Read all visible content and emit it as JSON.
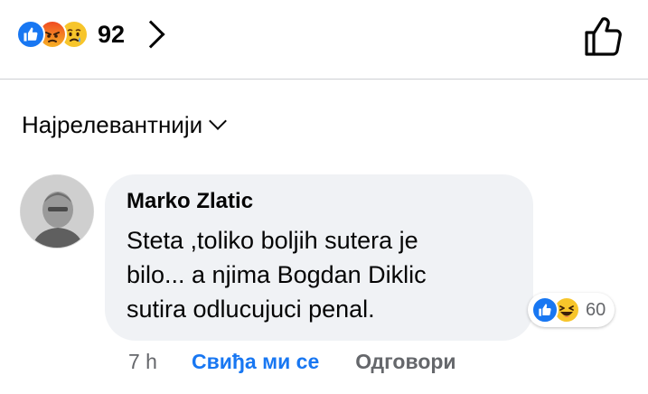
{
  "reactions": {
    "count": "92",
    "types": [
      "like-icon",
      "angry-icon",
      "sad-icon"
    ],
    "colors": {
      "like": "#1877f2",
      "angry": "#f04b22",
      "sad": "#f7c52b"
    }
  },
  "sort": {
    "label": "Најрелевантнији"
  },
  "comment": {
    "author": "Marko Zlatic",
    "text": "Steta ,toliko boljih sutera je\nbilo... a njima Bogdan Diklic\nsutira odlucujuci penal.",
    "reactions": {
      "count": "60",
      "types": [
        "like-icon",
        "haha-icon"
      ]
    },
    "time": "7 h",
    "like_label": "Свиђа ми се",
    "reply_label": "Одговори"
  },
  "colors": {
    "accent": "#1877f2",
    "secondary_text": "#65676b",
    "bubble_bg": "#f0f2f5"
  }
}
